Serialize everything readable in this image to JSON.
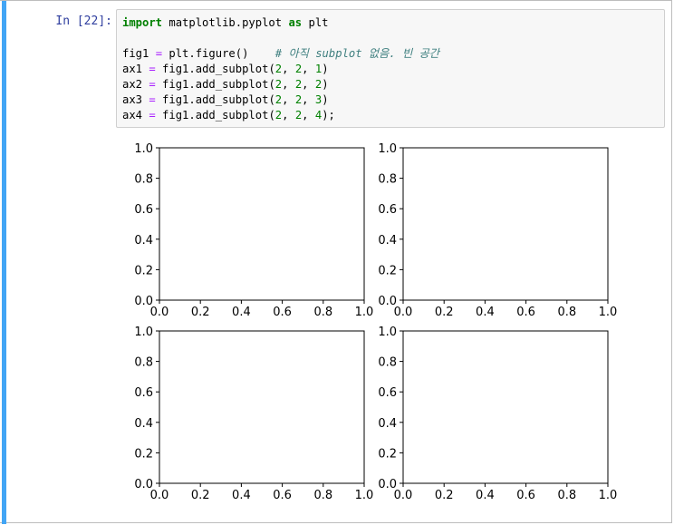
{
  "cell": {
    "prompt": "In [22]:",
    "code_lines": [
      [
        {
          "t": "import",
          "c": "kw"
        },
        {
          "t": " matplotlib.pyplot "
        },
        {
          "t": "as",
          "c": "kw"
        },
        {
          "t": " plt"
        }
      ],
      [],
      [
        {
          "t": "fig1 "
        },
        {
          "t": "=",
          "c": "op"
        },
        {
          "t": " plt.figure()    "
        },
        {
          "t": "# 아직 subplot 없음. 빈 공간",
          "c": "cm"
        }
      ],
      [
        {
          "t": "ax1 "
        },
        {
          "t": "=",
          "c": "op"
        },
        {
          "t": " fig1.add_subplot("
        },
        {
          "t": "2",
          "c": "num"
        },
        {
          "t": ", "
        },
        {
          "t": "2",
          "c": "num"
        },
        {
          "t": ", "
        },
        {
          "t": "1",
          "c": "num"
        },
        {
          "t": ")"
        }
      ],
      [
        {
          "t": "ax2 "
        },
        {
          "t": "=",
          "c": "op"
        },
        {
          "t": " fig1.add_subplot("
        },
        {
          "t": "2",
          "c": "num"
        },
        {
          "t": ", "
        },
        {
          "t": "2",
          "c": "num"
        },
        {
          "t": ", "
        },
        {
          "t": "2",
          "c": "num"
        },
        {
          "t": ")"
        }
      ],
      [
        {
          "t": "ax3 "
        },
        {
          "t": "=",
          "c": "op"
        },
        {
          "t": " fig1.add_subplot("
        },
        {
          "t": "2",
          "c": "num"
        },
        {
          "t": ", "
        },
        {
          "t": "2",
          "c": "num"
        },
        {
          "t": ", "
        },
        {
          "t": "3",
          "c": "num"
        },
        {
          "t": ")"
        }
      ],
      [
        {
          "t": "ax4 "
        },
        {
          "t": "=",
          "c": "op"
        },
        {
          "t": " fig1.add_subplot("
        },
        {
          "t": "2",
          "c": "num"
        },
        {
          "t": ", "
        },
        {
          "t": "2",
          "c": "num"
        },
        {
          "t": ", "
        },
        {
          "t": "4",
          "c": "num"
        },
        {
          "t": ");"
        }
      ]
    ]
  },
  "colors": {
    "cell_bar": "#42a5f5",
    "prompt": "#303f9f",
    "keyword": "#008000",
    "operator": "#aa22ff",
    "number": "#008000",
    "comment": "#408080"
  },
  "chart_data": [
    {
      "type": "scatter",
      "xlim": [
        0,
        1
      ],
      "ylim": [
        0,
        1
      ],
      "x_ticks": [
        "0.0",
        "0.2",
        "0.4",
        "0.6",
        "0.8",
        "1.0"
      ],
      "y_ticks": [
        "0.0",
        "0.2",
        "0.4",
        "0.6",
        "0.8",
        "1.0"
      ],
      "series": [],
      "grid": false
    },
    {
      "type": "scatter",
      "xlim": [
        0,
        1
      ],
      "ylim": [
        0,
        1
      ],
      "x_ticks": [
        "0.0",
        "0.2",
        "0.4",
        "0.6",
        "0.8",
        "1.0"
      ],
      "y_ticks": [
        "0.0",
        "0.2",
        "0.4",
        "0.6",
        "0.8",
        "1.0"
      ],
      "series": [],
      "grid": false
    },
    {
      "type": "scatter",
      "xlim": [
        0,
        1
      ],
      "ylim": [
        0,
        1
      ],
      "x_ticks": [
        "0.0",
        "0.2",
        "0.4",
        "0.6",
        "0.8",
        "1.0"
      ],
      "y_ticks": [
        "0.0",
        "0.2",
        "0.4",
        "0.6",
        "0.8",
        "1.0"
      ],
      "series": [],
      "grid": false
    },
    {
      "type": "scatter",
      "xlim": [
        0,
        1
      ],
      "ylim": [
        0,
        1
      ],
      "x_ticks": [
        "0.0",
        "0.2",
        "0.4",
        "0.6",
        "0.8",
        "1.0"
      ],
      "y_ticks": [
        "0.0",
        "0.2",
        "0.4",
        "0.6",
        "0.8",
        "1.0"
      ],
      "series": [],
      "grid": false
    }
  ]
}
